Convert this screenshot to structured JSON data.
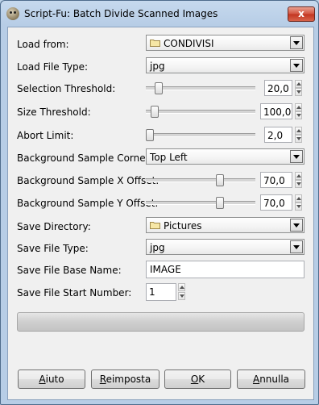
{
  "window": {
    "title": "Script-Fu: Batch Divide Scanned Images",
    "close_label": "x"
  },
  "form": {
    "load_from": {
      "label": "Load from:",
      "value": "CONDIVISI",
      "icon": "folder-icon"
    },
    "load_file_type": {
      "label": "Load File Type:",
      "value": "jpg"
    },
    "selection_threshold": {
      "label": "Selection Threshold:",
      "value": "20,0",
      "slider_fraction": 0.12
    },
    "size_threshold": {
      "label": "Size Threshold:",
      "value": "100,0",
      "slider_fraction": 0.08
    },
    "abort_limit": {
      "label": "Abort Limit:",
      "value": "2,0",
      "slider_fraction": 0.04
    },
    "background_sample_corner": {
      "label": "Background Sample Corner:",
      "value": "Top Left"
    },
    "background_sample_x_offset": {
      "label": "Background Sample X Offset:",
      "value": "70,0",
      "slider_fraction": 0.68
    },
    "background_sample_y_offset": {
      "label": "Background Sample Y Offset:",
      "value": "70,0",
      "slider_fraction": 0.68
    },
    "save_directory": {
      "label": "Save Directory:",
      "value": "Pictures",
      "icon": "folder-icon"
    },
    "save_file_type": {
      "label": "Save File Type:",
      "value": "jpg"
    },
    "save_file_base_name": {
      "label": "Save File Base Name:",
      "value": "IMAGE"
    },
    "save_file_start_number": {
      "label": "Save File Start Number:",
      "value": "1"
    }
  },
  "progress": {
    "value": 0
  },
  "buttons": {
    "help": {
      "mnemonic": "A",
      "rest": "iuto"
    },
    "reset": {
      "mnemonic": "R",
      "rest": "eimposta"
    },
    "ok": {
      "mnemonic": "O",
      "rest": "K"
    },
    "cancel": {
      "mnemonic": "A",
      "rest": "nnulla"
    }
  }
}
